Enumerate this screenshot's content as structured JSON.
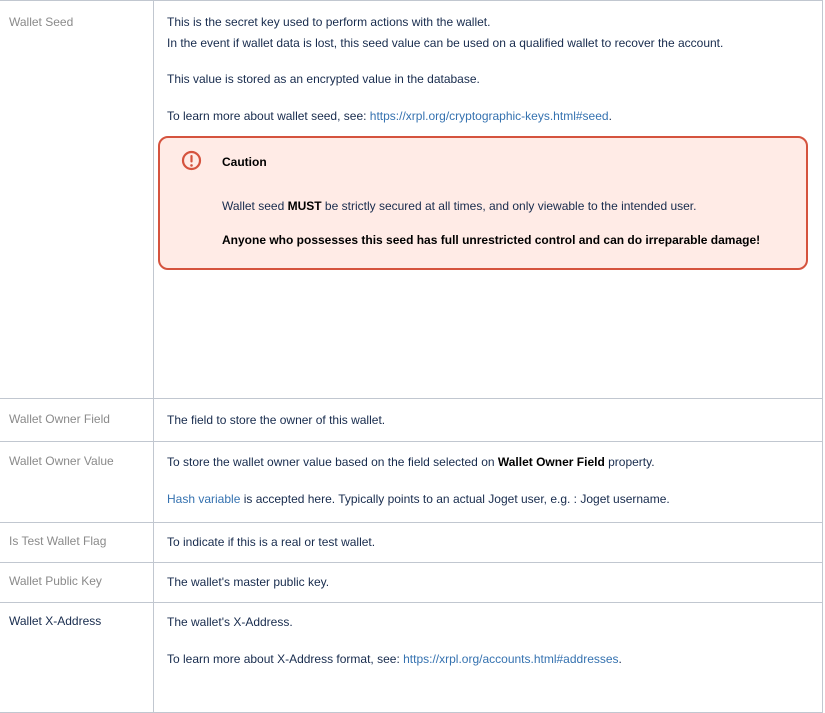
{
  "rows": {
    "wallet_seed": {
      "label": "Wallet Seed",
      "line1": "This is the secret key used to perform actions with the wallet.",
      "line2": "In the event if wallet data is lost, this seed value can be used on a qualified wallet to recover the account.",
      "line3": "This value is stored as an encrypted value in the database.",
      "learn_prefix": "To learn more about wallet seed, see: ",
      "learn_link": "https://xrpl.org/cryptographic-keys.html#seed",
      "learn_suffix": ".",
      "caution": {
        "icon": "exclamation-circle-icon",
        "title": "Caution",
        "text_prefix": "Wallet seed ",
        "text_bold": "MUST",
        "text_suffix": " be strictly secured at all times, and only viewable to the intended user.",
        "warning": "Anyone who possesses this seed has full unrestricted control and can do irreparable damage!"
      }
    },
    "wallet_owner_field": {
      "label": "Wallet Owner Field",
      "desc": "The field to store the owner of this wallet."
    },
    "wallet_owner_value": {
      "label": "Wallet Owner Value",
      "desc_prefix": "To store the wallet owner value based on the field selected on ",
      "desc_bold": "Wallet Owner Field",
      "desc_suffix": " property.",
      "link": "Hash variable",
      "note": " is accepted here. Typically points to an actual Joget user, e.g. : Joget username."
    },
    "is_test_wallet_flag": {
      "label": "Is Test Wallet Flag",
      "desc": "To indicate if this is a real or test wallet."
    },
    "wallet_public_key": {
      "label": "Wallet Public Key",
      "desc": "The wallet's master public key."
    },
    "wallet_x_address": {
      "label": "Wallet X-Address",
      "desc": "The wallet's X-Address.",
      "learn_prefix": "To learn more about X-Address format, see: ",
      "learn_link": "https://xrpl.org/accounts.html#addresses",
      "learn_suffix": "."
    }
  },
  "colors": {
    "link": "#3572b0",
    "caution_border": "#d5533e",
    "caution_bg": "#ffebe6",
    "grid": "#c1c7d0"
  }
}
